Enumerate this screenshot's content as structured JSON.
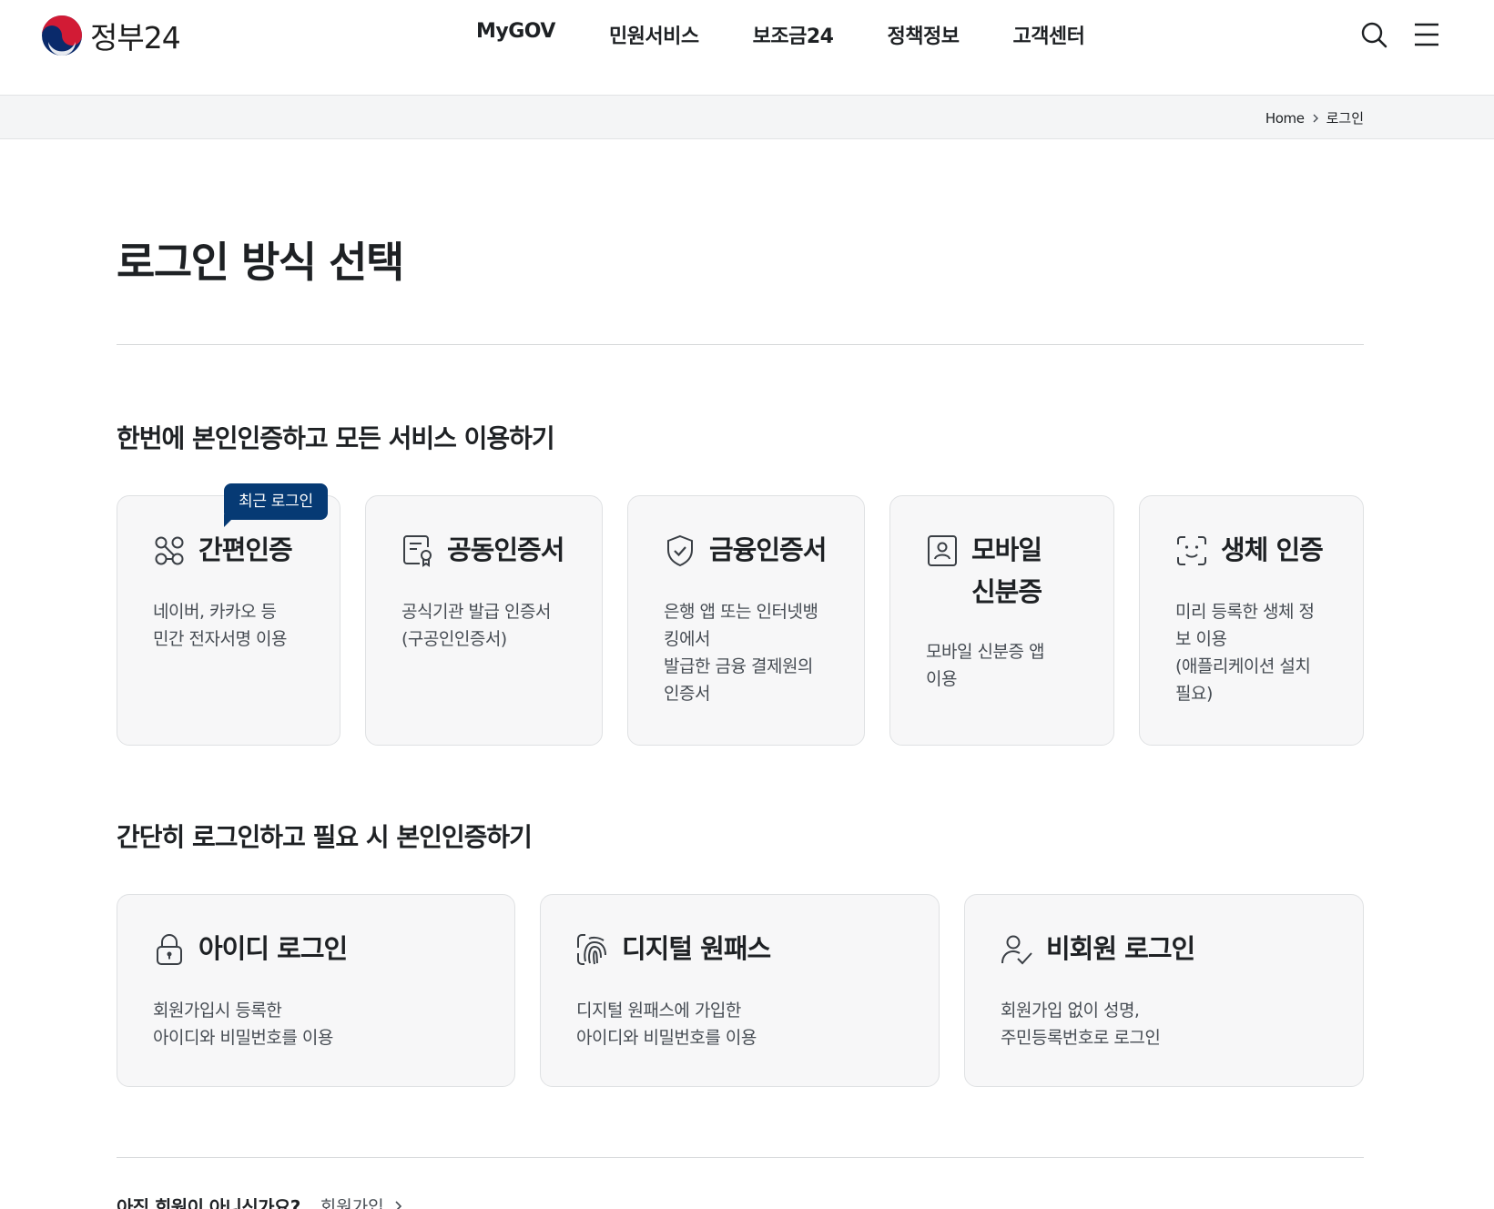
{
  "header": {
    "logo_text": "정부24",
    "nav": [
      "MyGOV",
      "민원서비스",
      "보조금24",
      "정책정보",
      "고객센터"
    ]
  },
  "breadcrumb": {
    "home": "Home",
    "current": "로그인"
  },
  "page_title": "로그인 방식 선택",
  "section1": {
    "title": "한번에 본인인증하고 모든 서비스 이용하기",
    "badge": "최근 로그인",
    "cards": [
      {
        "title": "간편인증",
        "desc": "네이버, 카카오 등\n민간 전자서명 이용",
        "icon": "flow-nodes-icon"
      },
      {
        "title": "공동인증서",
        "desc": "공식기관 발급 인증서\n(구공인인증서)",
        "icon": "certificate-icon"
      },
      {
        "title": "금융인증서",
        "desc": "은행 앱 또는 인터넷뱅\n킹에서\n발급한 금융 결제원의\n인증서",
        "icon": "shield-check-icon"
      },
      {
        "title": "모바일\n신분증",
        "desc": "모바일 신분증 앱\n이용",
        "icon": "id-card-icon"
      },
      {
        "title": "생체 인증",
        "desc": "미리 등록한 생체 정\n보 이용\n(애플리케이션 설치\n필요)",
        "icon": "face-scan-icon"
      }
    ]
  },
  "section2": {
    "title": "간단히 로그인하고 필요 시 본인인증하기",
    "cards": [
      {
        "title": "아이디 로그인",
        "desc": "회원가입시 등록한\n아이디와 비밀번호를 이용",
        "icon": "lock-icon"
      },
      {
        "title": "디지털 원패스",
        "desc": "디지털 원패스에 가입한\n아이디와 비밀번호를 이용",
        "icon": "fingerprint-icon"
      },
      {
        "title": "비회원 로그인",
        "desc": "회원가입 없이 성명,\n주민등록번호로 로그인",
        "icon": "user-check-icon"
      }
    ]
  },
  "footer_prompt": {
    "question": "아직 회원이 아니신가요?",
    "link": "회원가입"
  },
  "colors": {
    "badge_bg": "#063a74",
    "card_bg": "#f7f7f8",
    "breadcrumb_bg": "#f4f5f6"
  }
}
